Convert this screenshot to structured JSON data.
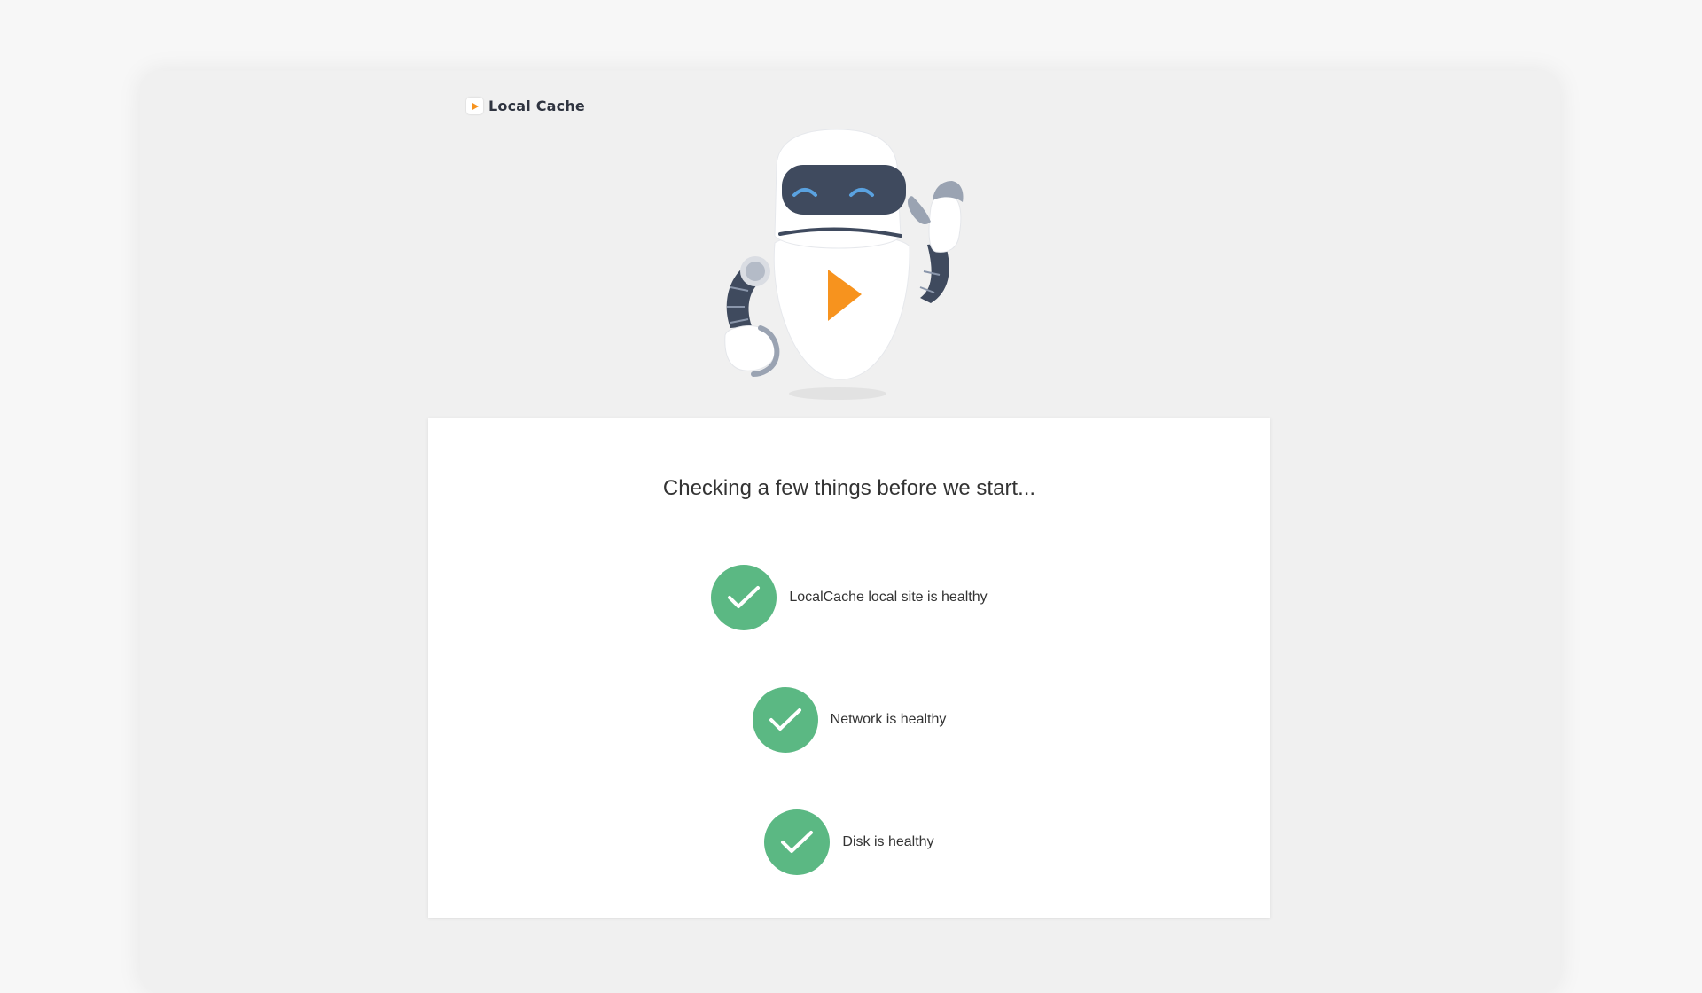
{
  "app": {
    "name": "Local Cache",
    "logo_icon": "play-logo-icon",
    "accent_color": "#f7931e"
  },
  "mascot": {
    "icon": "robot-mascot-icon"
  },
  "status": {
    "title": "Checking a few things before we start...",
    "checks": [
      {
        "label": "LocalCache local site is healthy",
        "state": "passed",
        "icon": "check-icon",
        "color": "#5bb883"
      },
      {
        "label": "Network is healthy",
        "state": "passed",
        "icon": "check-icon",
        "color": "#5bb883"
      },
      {
        "label": "Disk is healthy",
        "state": "passed",
        "icon": "check-icon",
        "color": "#5bb883"
      }
    ]
  }
}
